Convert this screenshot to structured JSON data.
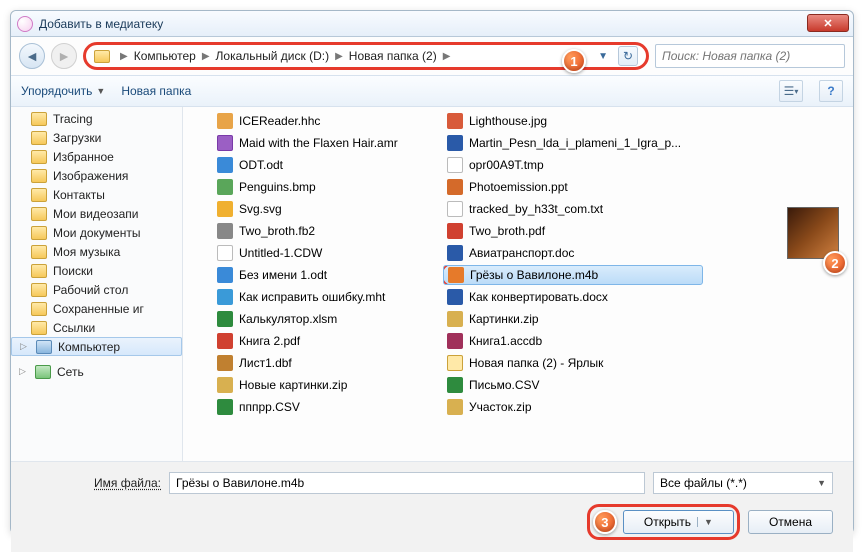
{
  "window": {
    "title": "Добавить в медиатеку"
  },
  "nav": {
    "crumbs": [
      "Компьютер",
      "Локальный диск (D:)",
      "Новая папка (2)"
    ],
    "search_placeholder": "Поиск: Новая папка (2)"
  },
  "toolbar": {
    "organize": "Упорядочить",
    "newfolder": "Новая папка"
  },
  "sidebar": {
    "items": [
      "Tracing",
      "Загрузки",
      "Избранное",
      "Изображения",
      "Контакты",
      "Мои видеозапи",
      "Мои документы",
      "Моя музыка",
      "Поиски",
      "Рабочий стол",
      "Сохраненные иг",
      "Ссылки"
    ],
    "computer": "Компьютер",
    "network": "Сеть"
  },
  "files": {
    "col1": [
      {
        "n": "ICEReader.hhc",
        "t": "hhc"
      },
      {
        "n": "Maid with the Flaxen Hair.amr",
        "t": "amr"
      },
      {
        "n": "ODT.odt",
        "t": "odt"
      },
      {
        "n": "Penguins.bmp",
        "t": "bmp"
      },
      {
        "n": "Svg.svg",
        "t": "svg"
      },
      {
        "n": "Two_broth.fb2",
        "t": "fb2"
      },
      {
        "n": "Untitled-1.CDW",
        "t": "cdw"
      },
      {
        "n": "Без имени 1.odt",
        "t": "odt"
      },
      {
        "n": "Как исправить ошибку.mht",
        "t": "mht"
      },
      {
        "n": "Калькулятор.xlsm",
        "t": "xls"
      },
      {
        "n": "Книга 2.pdf",
        "t": "pdf"
      },
      {
        "n": "Лист1.dbf",
        "t": "dbf"
      },
      {
        "n": "Новые картинки.zip",
        "t": "zip"
      },
      {
        "n": "пппрр.CSV",
        "t": "csv"
      }
    ],
    "col2": [
      {
        "n": "Lighthouse.jpg",
        "t": "jpg"
      },
      {
        "n": "Martin_Pesn_lda_i_plameni_1_Igra_p...",
        "t": "doc"
      },
      {
        "n": "opr00A9T.tmp",
        "t": "tmp"
      },
      {
        "n": "Photoemission.ppt",
        "t": "ppt"
      },
      {
        "n": "tracked_by_h33t_com.txt",
        "t": "txt"
      },
      {
        "n": "Two_broth.pdf",
        "t": "pdf"
      },
      {
        "n": "Авиатранспорт.doc",
        "t": "doc"
      },
      {
        "n": "Грёзы о Вавилоне.m4b",
        "t": "m4b",
        "sel": true
      },
      {
        "n": "Как конвертировать.docx",
        "t": "doc"
      },
      {
        "n": "Картинки.zip",
        "t": "zip"
      },
      {
        "n": "Книга1.accdb",
        "t": "acc"
      },
      {
        "n": "Новая папка (2) - Ярлык",
        "t": "lnk"
      },
      {
        "n": "Письмо.CSV",
        "t": "csv"
      },
      {
        "n": "Участок.zip",
        "t": "zip"
      }
    ]
  },
  "footer": {
    "filename_label": "Имя файла:",
    "filename_value": "Грёзы о Вавилоне.m4b",
    "filter": "Все файлы (*.*)",
    "open": "Открыть",
    "cancel": "Отмена"
  },
  "markers": {
    "m1": "1",
    "m2": "2",
    "m3": "3"
  }
}
